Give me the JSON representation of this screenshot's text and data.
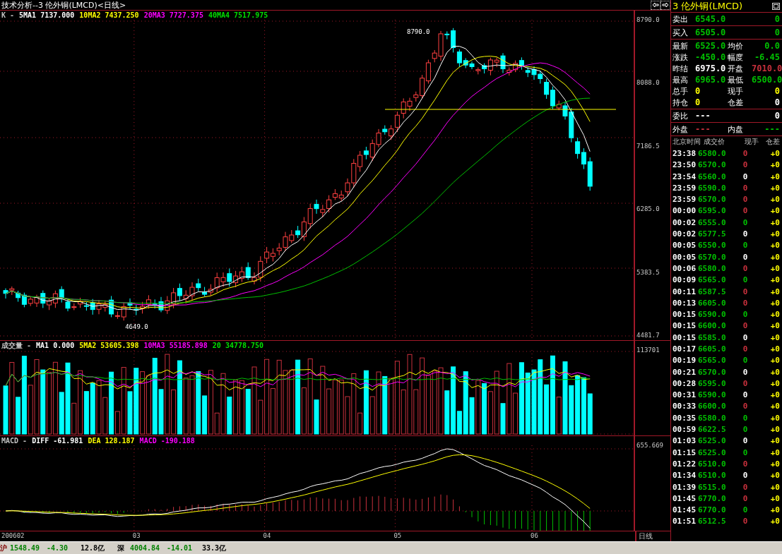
{
  "title": "技术分析--3 伦外铜(LMCD)<日线>",
  "price_panel": {
    "legend": [
      {
        "text": "K -",
        "color": "#c0c0c0"
      },
      {
        "text": "5MA1 7137.000",
        "color": "#ffffff"
      },
      {
        "text": "10MA2 7437.250",
        "color": "#ffff00"
      },
      {
        "text": "20MA3 7727.375",
        "color": "#ff00ff"
      },
      {
        "text": "40MA4 7517.975",
        "color": "#00e000"
      }
    ],
    "axis_labels": [
      "8790.0",
      "8088.0",
      "7186.5",
      "6285.0",
      "5383.5",
      "4481.7"
    ],
    "high_label": "8790.0",
    "low_label": "4649.0"
  },
  "volume_panel": {
    "legend": [
      {
        "text": "成交量 -",
        "color": "#c0c0c0"
      },
      {
        "text": "MA1 0.000",
        "color": "#ffffff"
      },
      {
        "text": "5MA2 53605.398",
        "color": "#ffff00"
      },
      {
        "text": "10MA3 55185.898",
        "color": "#ff00ff"
      },
      {
        "text": "20 34778.750",
        "color": "#00e000"
      }
    ],
    "axis_label": "113701"
  },
  "macd_panel": {
    "legend": [
      {
        "text": "MACD -",
        "color": "#c0c0c0"
      },
      {
        "text": "DIFF -61.981",
        "color": "#ffffff"
      },
      {
        "text": "DEA 128.187",
        "color": "#ffff00"
      },
      {
        "text": "MACD -190.188",
        "color": "#ff00ff"
      }
    ],
    "axis_label": "655.669"
  },
  "x_axis": {
    "labels": [
      "200602",
      "03",
      "04",
      "05",
      "06"
    ],
    "period": "日线"
  },
  "quote": {
    "header": "3 伦外铜(LMCD)",
    "groups": [
      [
        {
          "kind": "single",
          "label": "卖出",
          "value": {
            "text": "6545.0",
            "color": "#00c000"
          },
          "volume": {
            "text": "0",
            "color": "#00c000"
          }
        }
      ],
      [
        {
          "kind": "single",
          "label": "买入",
          "value": {
            "text": "6505.0",
            "color": "#00c000"
          },
          "volume": {
            "text": "0",
            "color": "#00c000"
          }
        }
      ],
      [
        {
          "kind": "pair",
          "label": "最新",
          "value": {
            "text": "6525.0",
            "color": "#00c000"
          },
          "label2": "均价",
          "value2": {
            "text": "0.0",
            "color": "#00c000"
          }
        },
        {
          "kind": "pair",
          "label": "涨跌",
          "value": {
            "text": "-450.0",
            "color": "#00c000"
          },
          "label2": "幅度",
          "value2": {
            "text": "-6.45",
            "color": "#00c000"
          }
        },
        {
          "kind": "pair",
          "label": "昨结",
          "value": {
            "text": "6975.0",
            "color": "#ffffff"
          },
          "label2": "开盘",
          "value2": {
            "text": "7010.0",
            "color": "#c8303c"
          }
        },
        {
          "kind": "pair",
          "label": "最高",
          "value": {
            "text": "6965.0",
            "color": "#00c000"
          },
          "label2": "最低",
          "value2": {
            "text": "6500.0",
            "color": "#00c000"
          }
        },
        {
          "kind": "pair",
          "label": "总手",
          "value": {
            "text": "0",
            "color": "#ffff00"
          },
          "label2": "现手",
          "value2": {
            "text": "0",
            "color": "#ffff00"
          }
        },
        {
          "kind": "pair",
          "label": "持仓",
          "value": {
            "text": "0",
            "color": "#ffff00"
          },
          "label2": "仓差",
          "value2": {
            "text": "0",
            "color": "#ffffff"
          }
        }
      ],
      [
        {
          "kind": "single",
          "label": "委比",
          "value": {
            "text": "---",
            "color": "#ffffff"
          },
          "volume": {
            "text": "0",
            "color": "#ffffff"
          }
        }
      ],
      [
        {
          "kind": "pair",
          "label": "外盘",
          "value": {
            "text": "---",
            "color": "#c8303c"
          },
          "label2": "内盘",
          "value2": {
            "text": "---",
            "color": "#00c000"
          }
        }
      ]
    ]
  },
  "ticks": {
    "columns": [
      "北京时间",
      "成交价",
      "现手",
      "仓差"
    ],
    "rows": [
      {
        "time": "23:38",
        "price": "6580.0",
        "volume": "0",
        "color": "#c8303c",
        "change": "+0"
      },
      {
        "time": "23:50",
        "price": "6570.0",
        "volume": "0",
        "color": "#c8303c",
        "change": "+0"
      },
      {
        "time": "23:54",
        "price": "6560.0",
        "volume": "0",
        "color": "#ffffff",
        "change": "+0"
      },
      {
        "time": "23:59",
        "price": "6590.0",
        "volume": "0",
        "color": "#c8303c",
        "change": "+0"
      },
      {
        "time": "23:59",
        "price": "6570.0",
        "volume": "0",
        "color": "#c8303c",
        "change": "+0"
      },
      {
        "time": "00:00",
        "price": "6595.0",
        "volume": "0",
        "color": "#c8303c",
        "change": "+0"
      },
      {
        "time": "00:02",
        "price": "6555.0",
        "volume": "0",
        "color": "#00c000",
        "change": "+0"
      },
      {
        "time": "00:02",
        "price": "6577.5",
        "volume": "0",
        "color": "#ffffff",
        "change": "+0"
      },
      {
        "time": "00:05",
        "price": "6550.0",
        "volume": "0",
        "color": "#00c000",
        "change": "+0"
      },
      {
        "time": "00:05",
        "price": "6570.0",
        "volume": "0",
        "color": "#ffffff",
        "change": "+0"
      },
      {
        "time": "00:06",
        "price": "6580.0",
        "volume": "0",
        "color": "#c8303c",
        "change": "+0"
      },
      {
        "time": "00:09",
        "price": "6565.0",
        "volume": "0",
        "color": "#00c000",
        "change": "+0"
      },
      {
        "time": "00:11",
        "price": "6587.5",
        "volume": "0",
        "color": "#c8303c",
        "change": "+0"
      },
      {
        "time": "00:13",
        "price": "6605.0",
        "volume": "0",
        "color": "#c8303c",
        "change": "+0"
      },
      {
        "time": "00:15",
        "price": "6590.0",
        "volume": "0",
        "color": "#00c000",
        "change": "+0"
      },
      {
        "time": "00:15",
        "price": "6600.0",
        "volume": "0",
        "color": "#c8303c",
        "change": "+0"
      },
      {
        "time": "00:15",
        "price": "6585.0",
        "volume": "0",
        "color": "#ffffff",
        "change": "+0"
      },
      {
        "time": "00:17",
        "price": "6605.0",
        "volume": "0",
        "color": "#c8303c",
        "change": "+0"
      },
      {
        "time": "00:19",
        "price": "6565.0",
        "volume": "0",
        "color": "#00c000",
        "change": "+0"
      },
      {
        "time": "00:21",
        "price": "6570.0",
        "volume": "0",
        "color": "#ffffff",
        "change": "+0"
      },
      {
        "time": "00:28",
        "price": "6595.0",
        "volume": "0",
        "color": "#c8303c",
        "change": "+0"
      },
      {
        "time": "00:31",
        "price": "6590.0",
        "volume": "0",
        "color": "#ffffff",
        "change": "+0"
      },
      {
        "time": "00:33",
        "price": "6600.0",
        "volume": "0",
        "color": "#c8303c",
        "change": "+0"
      },
      {
        "time": "00:35",
        "price": "6580.0",
        "volume": "0",
        "color": "#00c000",
        "change": "+0"
      },
      {
        "time": "00:59",
        "price": "6622.5",
        "volume": "0",
        "color": "#00c000",
        "change": "+0"
      },
      {
        "time": "01:03",
        "price": "6525.0",
        "volume": "0",
        "color": "#ffffff",
        "change": "+0"
      },
      {
        "time": "01:15",
        "price": "6525.0",
        "volume": "0",
        "color": "#00c000",
        "change": "+0"
      },
      {
        "time": "01:22",
        "price": "6510.0",
        "volume": "0",
        "color": "#c8303c",
        "change": "+0"
      },
      {
        "time": "01:34",
        "price": "6510.0",
        "volume": "0",
        "color": "#ffffff",
        "change": "+0"
      },
      {
        "time": "01:39",
        "price": "6515.0",
        "volume": "0",
        "color": "#c8303c",
        "change": "+0"
      },
      {
        "time": "01:45",
        "price": "6770.0",
        "volume": "0",
        "color": "#c8303c",
        "change": "+0"
      },
      {
        "time": "01:45",
        "price": "6770.0",
        "volume": "0",
        "color": "#00c000",
        "change": "+0"
      },
      {
        "time": "01:51",
        "price": "6512.5",
        "volume": "0",
        "color": "#c8303c",
        "change": "+0"
      }
    ]
  },
  "status_bar": [
    {
      "text": "沪",
      "color": "#800000"
    },
    {
      "text": "1548.49",
      "color": "#008000"
    },
    {
      "text": "-4.30",
      "color": "#008000"
    },
    {
      "text": "12.8亿",
      "color": "#000000"
    },
    {
      "text": "深",
      "color": "#000000"
    },
    {
      "text": "4004.84",
      "color": "#008000"
    },
    {
      "text": "-14.01",
      "color": "#008000"
    },
    {
      "text": "33.3亿",
      "color": "#000000"
    }
  ]
}
